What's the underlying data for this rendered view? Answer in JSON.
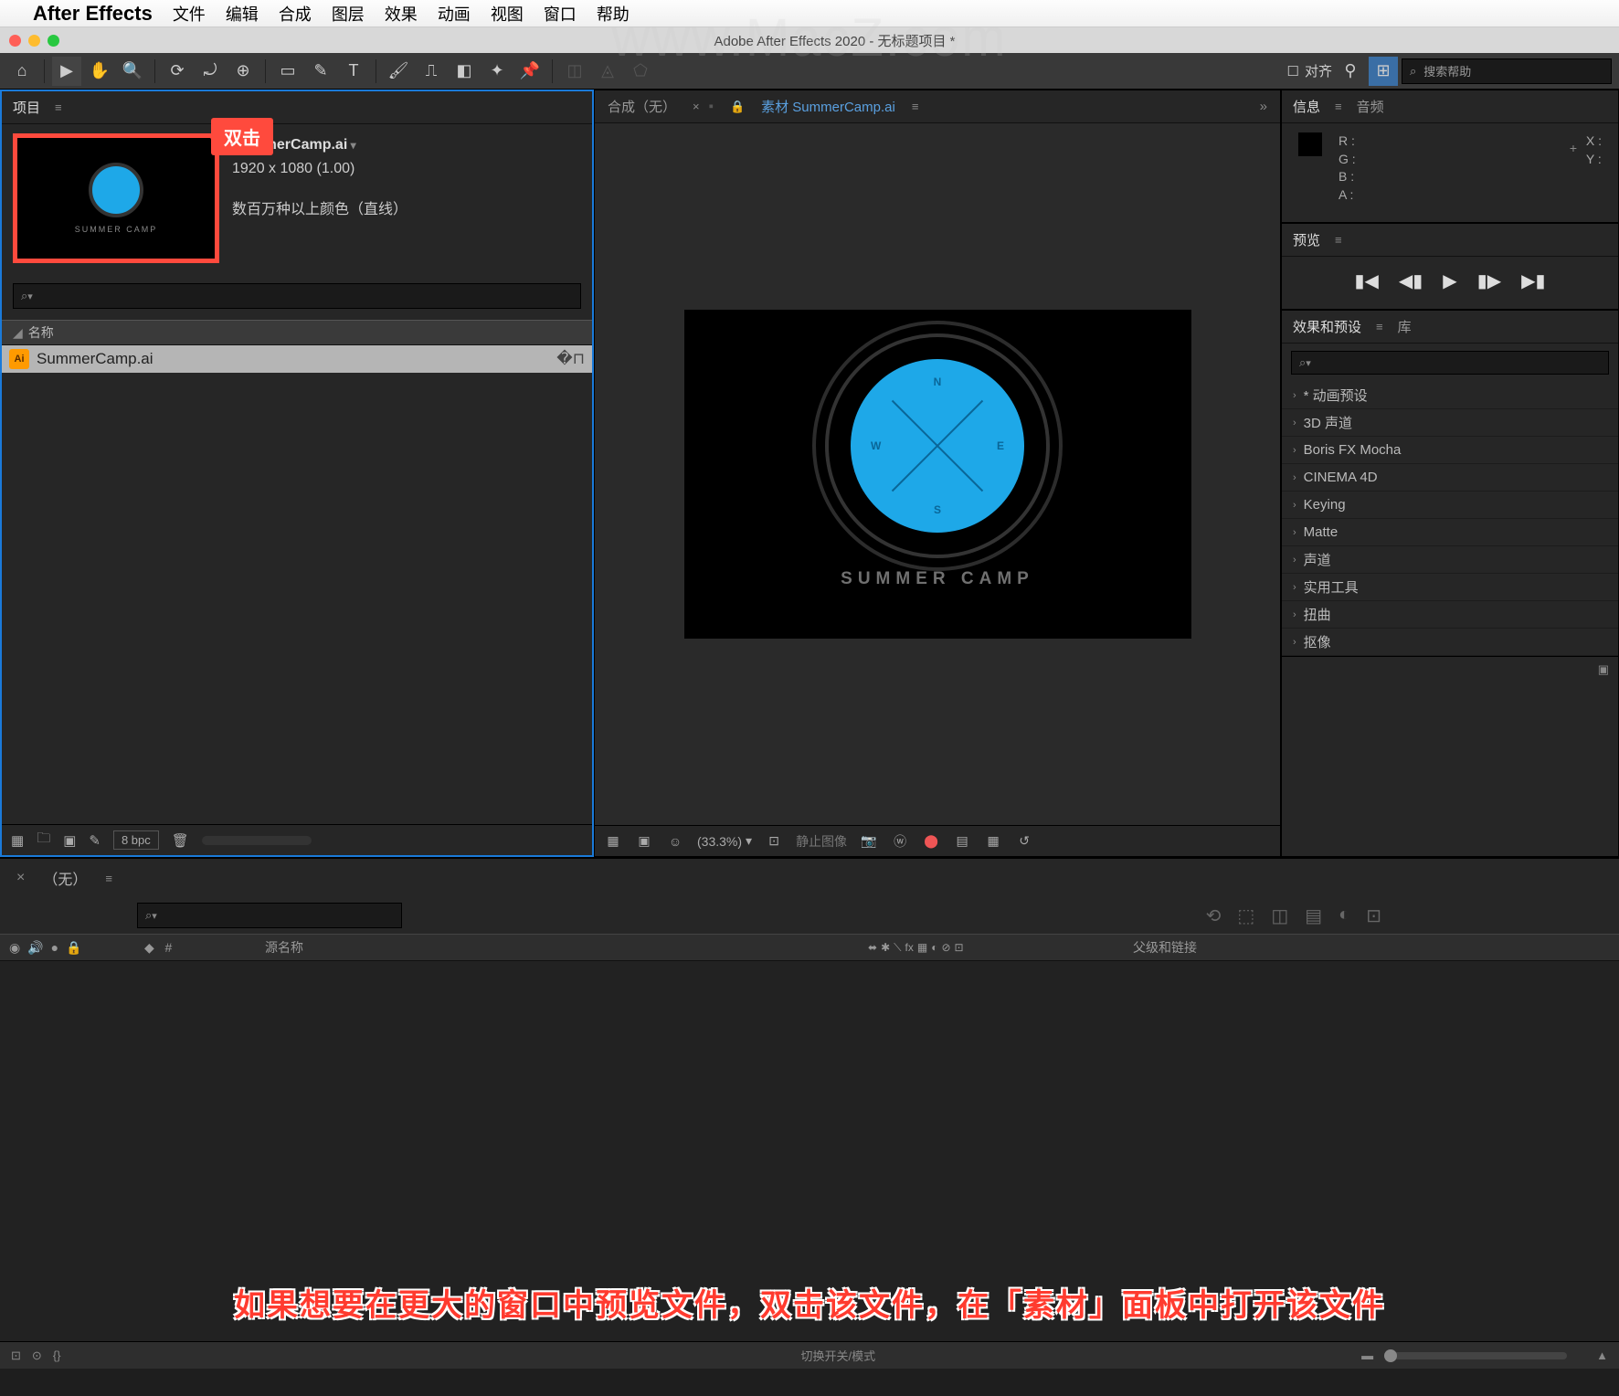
{
  "mac_menu": {
    "app": "After Effects",
    "items": [
      "文件",
      "编辑",
      "合成",
      "图层",
      "效果",
      "动画",
      "视图",
      "窗口",
      "帮助"
    ]
  },
  "title": "Adobe After Effects 2020 - 无标题项目 *",
  "toolbar": {
    "align": "对齐",
    "search_placeholder": "搜索帮助"
  },
  "project": {
    "tab": "项目",
    "callout": "双击",
    "thumb_label": "SUMMER CAMP",
    "file": "SummerCamp.ai",
    "dims": "1920 x 1080 (1.00)",
    "color": "数百万种以上颜色（直线）",
    "search": "⌕",
    "col_name": "名称",
    "item": "SummerCamp.ai",
    "bpc": "8 bpc"
  },
  "viewer": {
    "comp_tab": "合成（无）",
    "src_tab": "素材 SummerCamp.ai",
    "camp": "SUMMER CAMP",
    "dirs": {
      "n": "N",
      "e": "E",
      "s": "S",
      "w": "W"
    },
    "zoom": "(33.3%)",
    "status": "静止图像"
  },
  "info": {
    "tab": "信息",
    "audio": "音频",
    "r": "R :",
    "g": "G :",
    "b": "B :",
    "a": "A :",
    "x": "X :",
    "y": "Y :"
  },
  "preview": {
    "tab": "预览"
  },
  "effects": {
    "tab": "效果和预设",
    "lib": "库",
    "items": [
      "* 动画预设",
      "3D 声道",
      "Boris FX Mocha",
      "CINEMA 4D",
      "Keying",
      "Matte",
      "声道",
      "实用工具",
      "扭曲",
      "抠像"
    ]
  },
  "timeline": {
    "none": "（无）",
    "hash": "#",
    "src_name": "源名称",
    "parent": "父级和链接",
    "mode": "切换开关/模式"
  },
  "watermark": "www.MacZ.com",
  "annotation": "如果想要在更大的窗口中预览文件，双击该文件，在「素材」面板中打开该文件"
}
